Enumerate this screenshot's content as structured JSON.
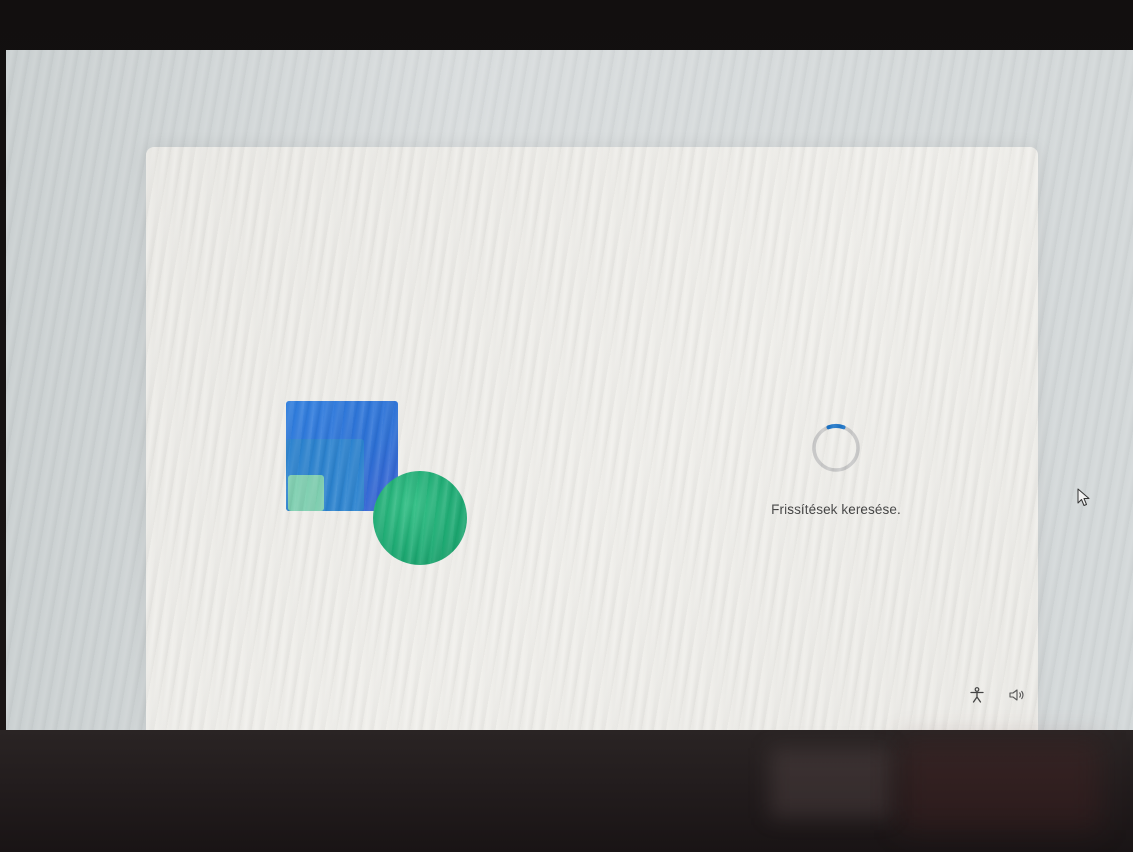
{
  "status": {
    "text": "Frissítések keresése."
  },
  "icons": {
    "spinner": "loading-spinner-icon",
    "accessibility": "accessibility-icon",
    "volume": "volume-icon",
    "cursor": "mouse-cursor-icon"
  },
  "colors": {
    "card_background": "#efeeea",
    "spinner_track": "#c8c8c8",
    "spinner_accent": "#1a73c7",
    "tile_blue": "#2f7fe0",
    "tile_mid": "#2a82cf",
    "tile_light": "#7ecfb0",
    "circle_green": "#1aa971"
  }
}
